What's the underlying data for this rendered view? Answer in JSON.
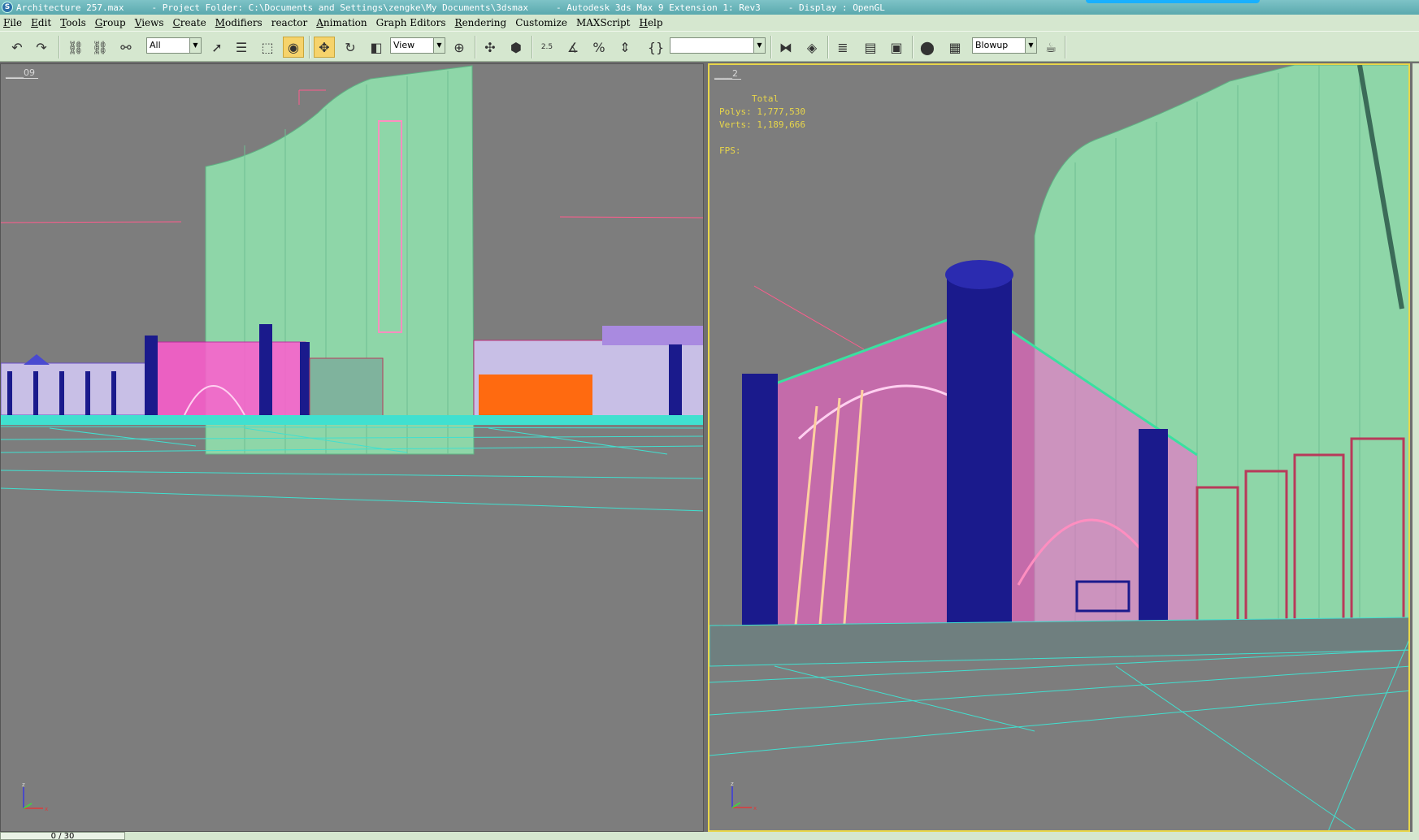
{
  "window": {
    "file": "Architecture 257.max",
    "project": "- Project Folder: C:\\Documents and Settings\\zengke\\My Documents\\3dsmax",
    "app": "- Autodesk 3ds Max 9 Extension 1: Rev3",
    "display": "- Display : OpenGL"
  },
  "menu": [
    {
      "u": "F",
      "rest": "ile"
    },
    {
      "u": "E",
      "rest": "dit"
    },
    {
      "u": "T",
      "rest": "ools"
    },
    {
      "u": "G",
      "rest": "roup"
    },
    {
      "u": "V",
      "rest": "iews"
    },
    {
      "u": "C",
      "rest": "reate"
    },
    {
      "u": "M",
      "rest": "odifiers"
    },
    {
      "u": "",
      "rest": "reactor"
    },
    {
      "u": "A",
      "rest": "nimation"
    },
    {
      "u": "",
      "rest": "Graph Editors"
    },
    {
      "u": "R",
      "rest": "endering"
    },
    {
      "u": "",
      "rest": "Customize"
    },
    {
      "u": "",
      "rest": "MAXScript"
    },
    {
      "u": "H",
      "rest": "elp"
    }
  ],
  "toolbar": {
    "selection_filter": "All",
    "reference_coord": "View",
    "named_selection": "",
    "render_preset": "Blowup",
    "snap_angle_label": "2.5"
  },
  "viewports": {
    "left": {
      "label": "09"
    },
    "right": {
      "label": "2",
      "stats_title": "Total",
      "polys_label": "Polys:",
      "polys": "1,777,530",
      "verts_label": "Verts:",
      "verts": "1,189,666",
      "fps_label": "FPS:"
    }
  },
  "timeline": {
    "frame": "0 / 30"
  },
  "colors": {
    "tower": "#8ed6a8",
    "column": "#1a1a8c",
    "arch": "#ff5ccf",
    "ground": "#40e0d0",
    "accent_orange": "#ff6a10",
    "accent_purple": "#a98ae0",
    "stats_text": "#e8d64a"
  }
}
